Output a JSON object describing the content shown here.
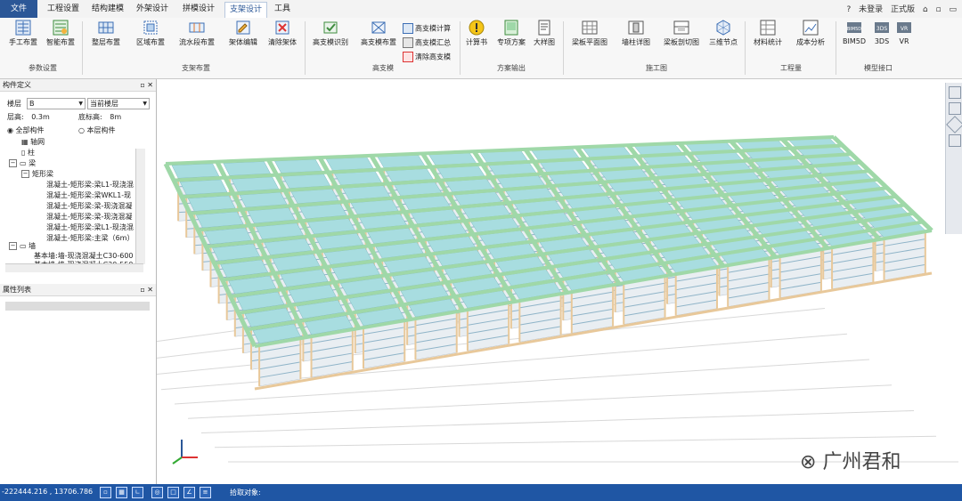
{
  "menu": {
    "file": "文件",
    "tabs": [
      "工程设置",
      "结构建模",
      "外架设计",
      "拼模设计",
      "支架设计",
      "工具"
    ],
    "active_tab": "支架设计",
    "help": "?",
    "login": "未登录",
    "edition": "正式版",
    "window_controls": [
      "⌂",
      "▫",
      "▭"
    ]
  },
  "ribbon": {
    "groups": [
      {
        "label": "参数设置",
        "buttons": [
          "手工布置",
          "智能布置"
        ]
      },
      {
        "label": "支架布置",
        "buttons": [
          "整层布置",
          "区域布置",
          "流水段布置",
          "架体编辑",
          "清除架体"
        ]
      },
      {
        "label": "高支模",
        "buttons": [
          "高支模识别",
          "高支模布置"
        ],
        "small": [
          "高支模计算",
          "高支模汇总",
          "清除高支模"
        ]
      },
      {
        "label": "方案输出",
        "buttons": [
          "计算书",
          "专项方案",
          "大样图"
        ]
      },
      {
        "label": "施工图",
        "buttons": [
          "梁板平面图",
          "墙柱详图",
          "梁板剖切图",
          "三维节点"
        ]
      },
      {
        "label": "工程量",
        "buttons": [
          "材料统计",
          "成本分析"
        ]
      },
      {
        "label": "模型接口",
        "buttons": [
          "BIM5D",
          "3DS",
          "VR"
        ]
      }
    ]
  },
  "component_panel": {
    "title": "构件定义",
    "floor_label": "楼层",
    "floor_value": "B",
    "floor_scope": "当前楼层",
    "height_label": "层高:",
    "height_value": "0.3m",
    "bottom_label": "底标高:",
    "bottom_value": "8m",
    "radio_all": "全部构件",
    "radio_floor": "本层构件",
    "tree": [
      "轴网",
      "柱",
      "梁",
      "矩形梁",
      "混凝土-矩形梁:梁L1-现浇混",
      "混凝土-矩形梁:梁WKL1-现",
      "混凝土-矩形梁:梁-现浇混凝",
      "混凝土-矩形梁:梁-现浇混凝",
      "混凝土-矩形梁:梁L1-现浇混",
      "混凝土-矩形梁:主梁（6m）",
      "墙",
      "基本墙:墙-现浇混凝土C30-600",
      "基本墙:墙-现浇混凝土C30-550"
    ]
  },
  "property_panel": {
    "title": "属性列表"
  },
  "watermark": {
    "text": "广州君和"
  },
  "status": {
    "coords": "-222444.216 , 13706.786",
    "pick_label": "拾取对象:"
  },
  "scene": {
    "grid_rows": 11,
    "grid_cols": 13,
    "beam_color": "#9fd8a8",
    "slab_color": "#a8dde0",
    "post_color": "#e8c89a"
  }
}
